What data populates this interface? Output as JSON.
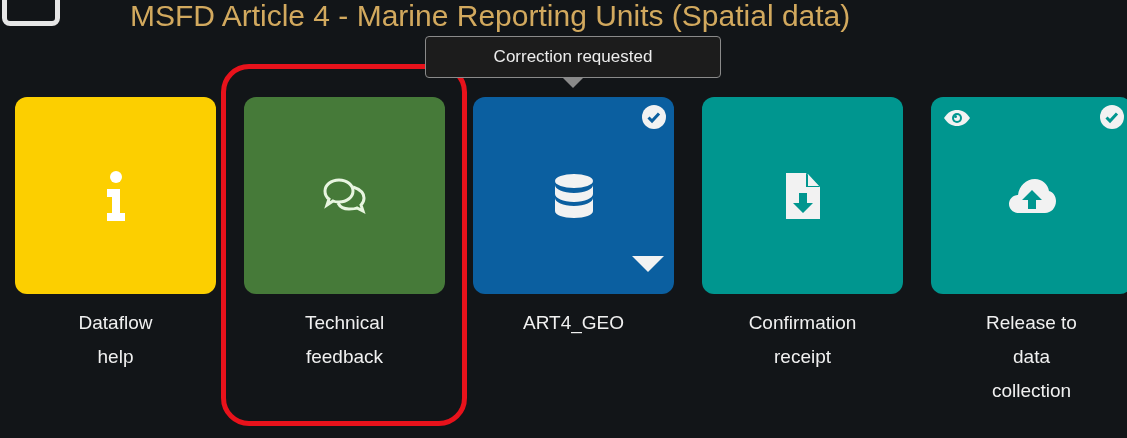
{
  "header": {
    "title": "MSFD Article 4 - Marine Reporting Units (Spatial data)"
  },
  "tiles": [
    {
      "label_lines": [
        "Dataflow",
        "help"
      ],
      "kind": "info",
      "color": "#fccf00",
      "checked": false,
      "viewable": false,
      "dropdown": false,
      "highlighted": false
    },
    {
      "label_lines": [
        "Technical",
        "feedback"
      ],
      "kind": "feedback",
      "color": "#467a39",
      "checked": false,
      "viewable": false,
      "dropdown": false,
      "highlighted": true
    },
    {
      "label_lines": [
        "ART4_GEO"
      ],
      "kind": "data",
      "color": "#0b5fa0",
      "checked": true,
      "viewable": false,
      "dropdown": true,
      "highlighted": false,
      "tooltip": "Correction requested"
    },
    {
      "label_lines": [
        "Confirmation",
        "receipt"
      ],
      "kind": "receipt",
      "color": "#00968f",
      "checked": false,
      "viewable": false,
      "dropdown": false,
      "highlighted": false
    },
    {
      "label_lines": [
        "Release to",
        "data",
        "collection"
      ],
      "kind": "release",
      "color": "#00968f",
      "checked": true,
      "viewable": true,
      "dropdown": false,
      "highlighted": false
    }
  ]
}
